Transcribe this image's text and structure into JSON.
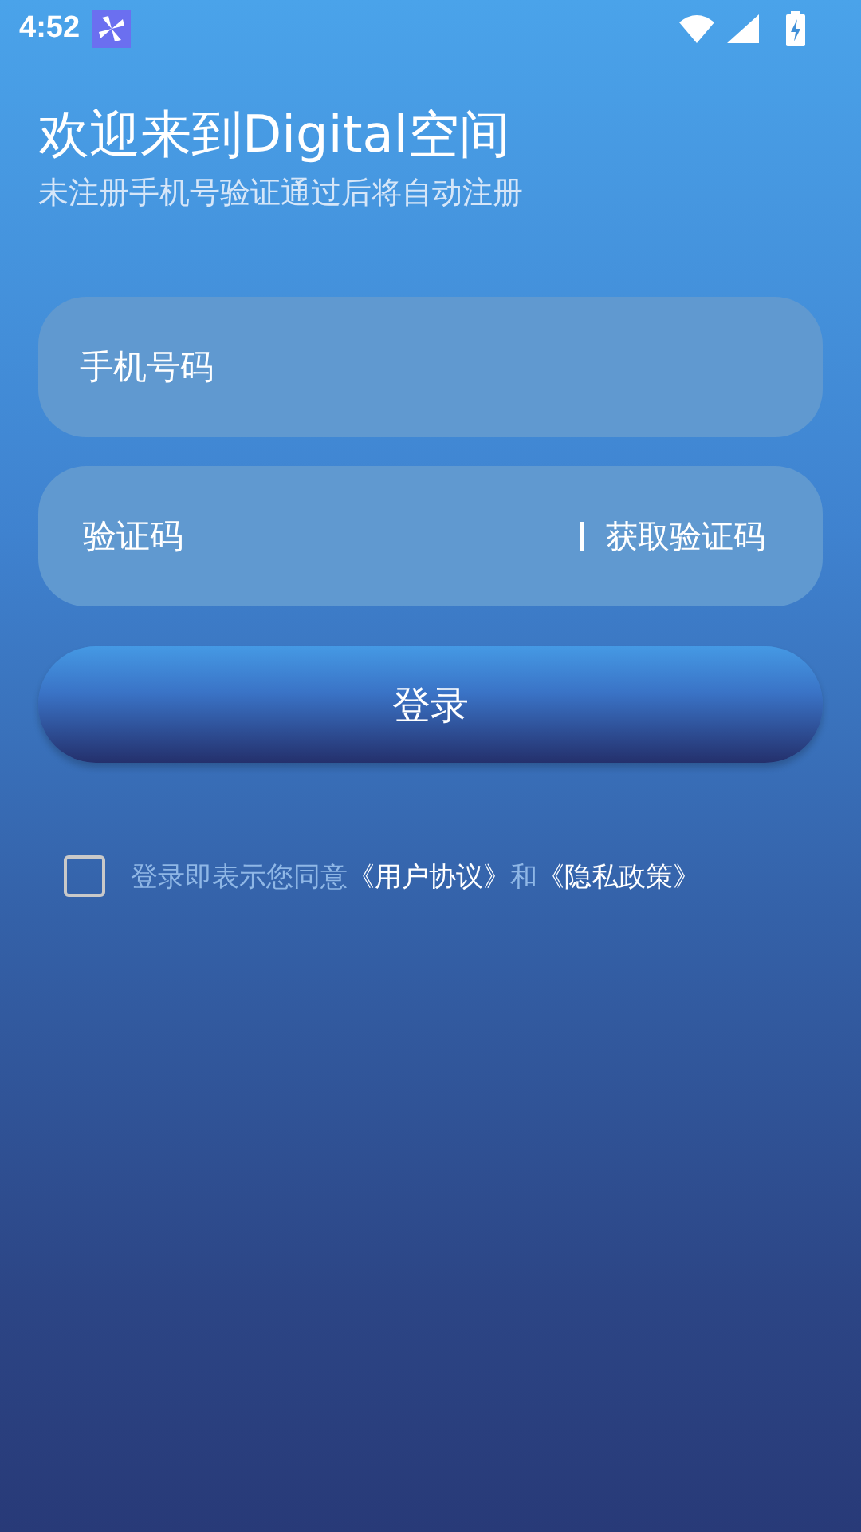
{
  "status_bar": {
    "time": "4:52"
  },
  "header": {
    "title": "欢迎来到Digital空间",
    "subtitle": "未注册手机号验证通过后将自动注册"
  },
  "phone_field": {
    "placeholder": "手机号码"
  },
  "code_field": {
    "placeholder": "验证码",
    "action": "获取验证码"
  },
  "login_button": {
    "label": "登录"
  },
  "agreement": {
    "checked": false,
    "parts": [
      {
        "kind": "text",
        "text": "登录即表示您同意"
      },
      {
        "kind": "link",
        "text": "《用户协议》"
      },
      {
        "kind": "text",
        "text": "和"
      },
      {
        "kind": "link",
        "text": "《隐私政策》"
      }
    ]
  }
}
